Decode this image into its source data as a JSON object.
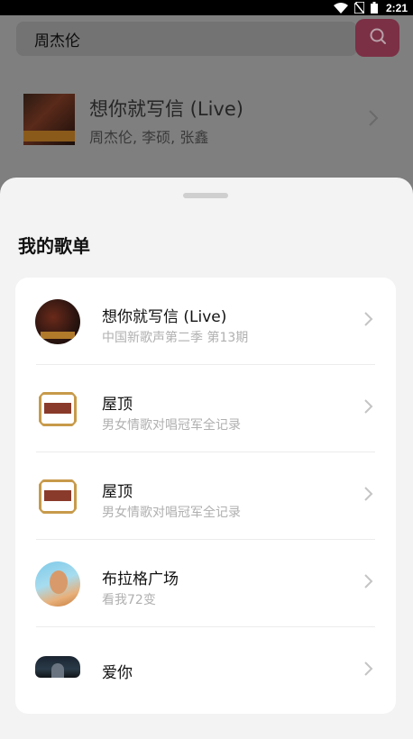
{
  "status_bar": {
    "time": "2:21"
  },
  "search": {
    "query": "周杰伦"
  },
  "background_result": {
    "title": "想你就写信 (Live)",
    "artists": "周杰伦, 李硕, 张鑫"
  },
  "sheet": {
    "title": "我的歌单",
    "items": [
      {
        "title": "想你就写信 (Live)",
        "subtitle": "中国新歌声第二季 第13期",
        "avatar": "album-cover-live"
      },
      {
        "title": "屋顶",
        "subtitle": "男女情歌对唱冠军全记录",
        "avatar": "album-cover-roof"
      },
      {
        "title": "屋顶",
        "subtitle": "男女情歌对唱冠军全记录",
        "avatar": "album-cover-roof"
      },
      {
        "title": "布拉格广场",
        "subtitle": "看我72变",
        "avatar": "album-cover-plaza"
      },
      {
        "title": "爱你",
        "subtitle": "",
        "avatar": "album-cover-love"
      }
    ]
  },
  "colors": {
    "accent": "#d4586f",
    "sheet_bg": "#f3f3f3",
    "card_bg": "#ffffff",
    "subtitle": "#b0b0b0"
  }
}
